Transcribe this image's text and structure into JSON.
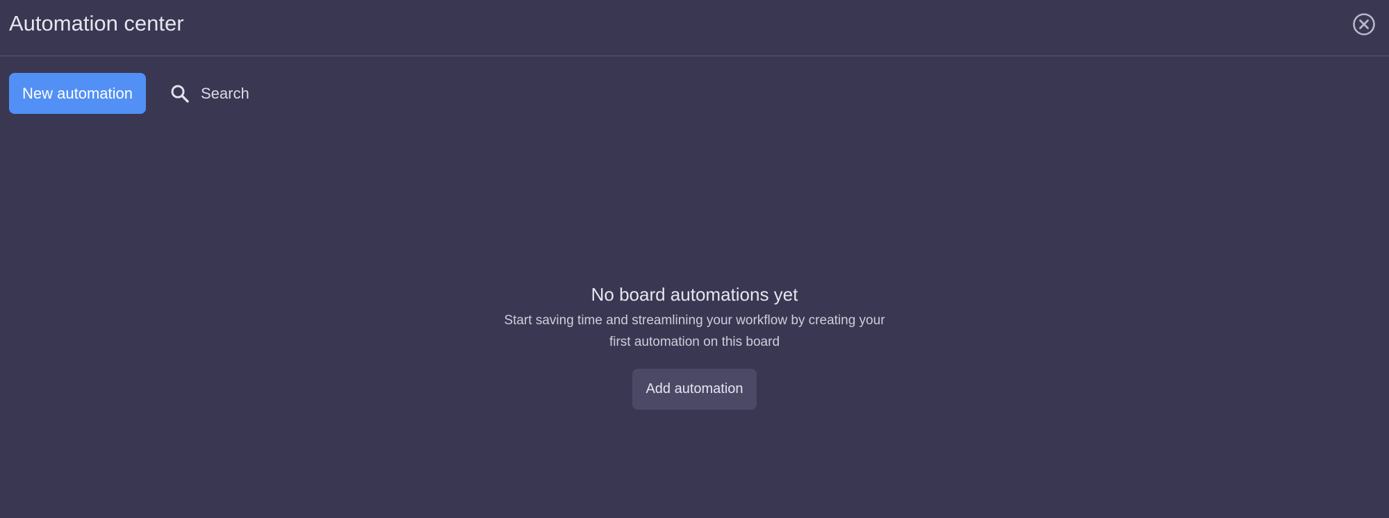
{
  "header": {
    "title": "Automation center",
    "close_icon": "close-circle-icon"
  },
  "toolbar": {
    "new_automation_label": "New automation",
    "search_label": "Search",
    "search_icon": "search-icon"
  },
  "empty_state": {
    "title": "No board automations yet",
    "description": "Start saving time and streamlining your workflow by creating your first automation on this board",
    "add_button_label": "Add automation"
  },
  "colors": {
    "background": "#393751",
    "primary_button": "#5290f5",
    "secondary_button": "#4b4966",
    "divider": "#5a5873"
  }
}
